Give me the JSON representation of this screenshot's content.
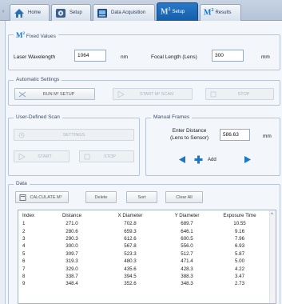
{
  "tabs": [
    {
      "label": "Home",
      "icon": "home-icon"
    },
    {
      "label": "Setup",
      "icon": "setup-gear-icon"
    },
    {
      "label": "Data Acquisition",
      "icon": "data-acquisition-icon"
    },
    {
      "label": "Setup",
      "prefix": "M",
      "sup": "2",
      "icon": "m2-logo-icon",
      "active": true
    },
    {
      "label": "Results",
      "prefix": "M",
      "sup": "2",
      "icon": "m2-logo-icon"
    }
  ],
  "fixed": {
    "legend_prefix": "M",
    "legend_sup": "2",
    "legend": "Fixed Values",
    "laser_wavelength_label": "Laser Wavelength",
    "laser_wavelength_value": "1064",
    "laser_unit": "nm",
    "focal_length_label": "Focal Length (Lens)",
    "focal_length_value": "300",
    "focal_unit": "mm"
  },
  "auto": {
    "legend": "Automatic Settings",
    "run_setup": "RUN M² SETUP",
    "start_m2_scan": "START M² SCAN",
    "stop": "STOP"
  },
  "user_scan": {
    "legend": "User-Defined Scan",
    "settings": "SETTINGS",
    "start": "START",
    "stop": "STOP"
  },
  "manual": {
    "legend": "Manual Frames",
    "enter_distance_line1": "Enter Distance",
    "enter_distance_line2": "(Lens to Sensor)",
    "distance_value": "586.63",
    "unit": "mm",
    "add": "Add"
  },
  "data": {
    "legend": "Data",
    "calculate": "CALCULATE M²",
    "delete": "Delete",
    "sort": "Sort",
    "clear_all": "Clear All",
    "columns": [
      "Index",
      "Distance",
      "X Diameter",
      "Y Diameter",
      "Exposure Time"
    ],
    "rows": [
      [
        "1",
        "271.0",
        "702.8",
        "689.7",
        "10.55"
      ],
      [
        "2",
        "280.6",
        "659.3",
        "646.1",
        "9.16"
      ],
      [
        "3",
        "290.3",
        "612.6",
        "600.5",
        "7.96"
      ],
      [
        "4",
        "300.0",
        "567.8",
        "556.0",
        "6.93"
      ],
      [
        "5",
        "309.7",
        "523.3",
        "512.7",
        "5.87"
      ],
      [
        "6",
        "319.3",
        "480.3",
        "471.4",
        "5.00"
      ],
      [
        "7",
        "329.0",
        "435.6",
        "428.3",
        "4.22"
      ],
      [
        "8",
        "338.7",
        "394.5",
        "388.3",
        "3.47"
      ],
      [
        "9",
        "348.4",
        "352.6",
        "348.3",
        "2.73"
      ]
    ]
  },
  "colors": {
    "accent": "#1e74c8",
    "tab_active": "#1a6bbd",
    "nav_arrow": "#1e74c8"
  }
}
